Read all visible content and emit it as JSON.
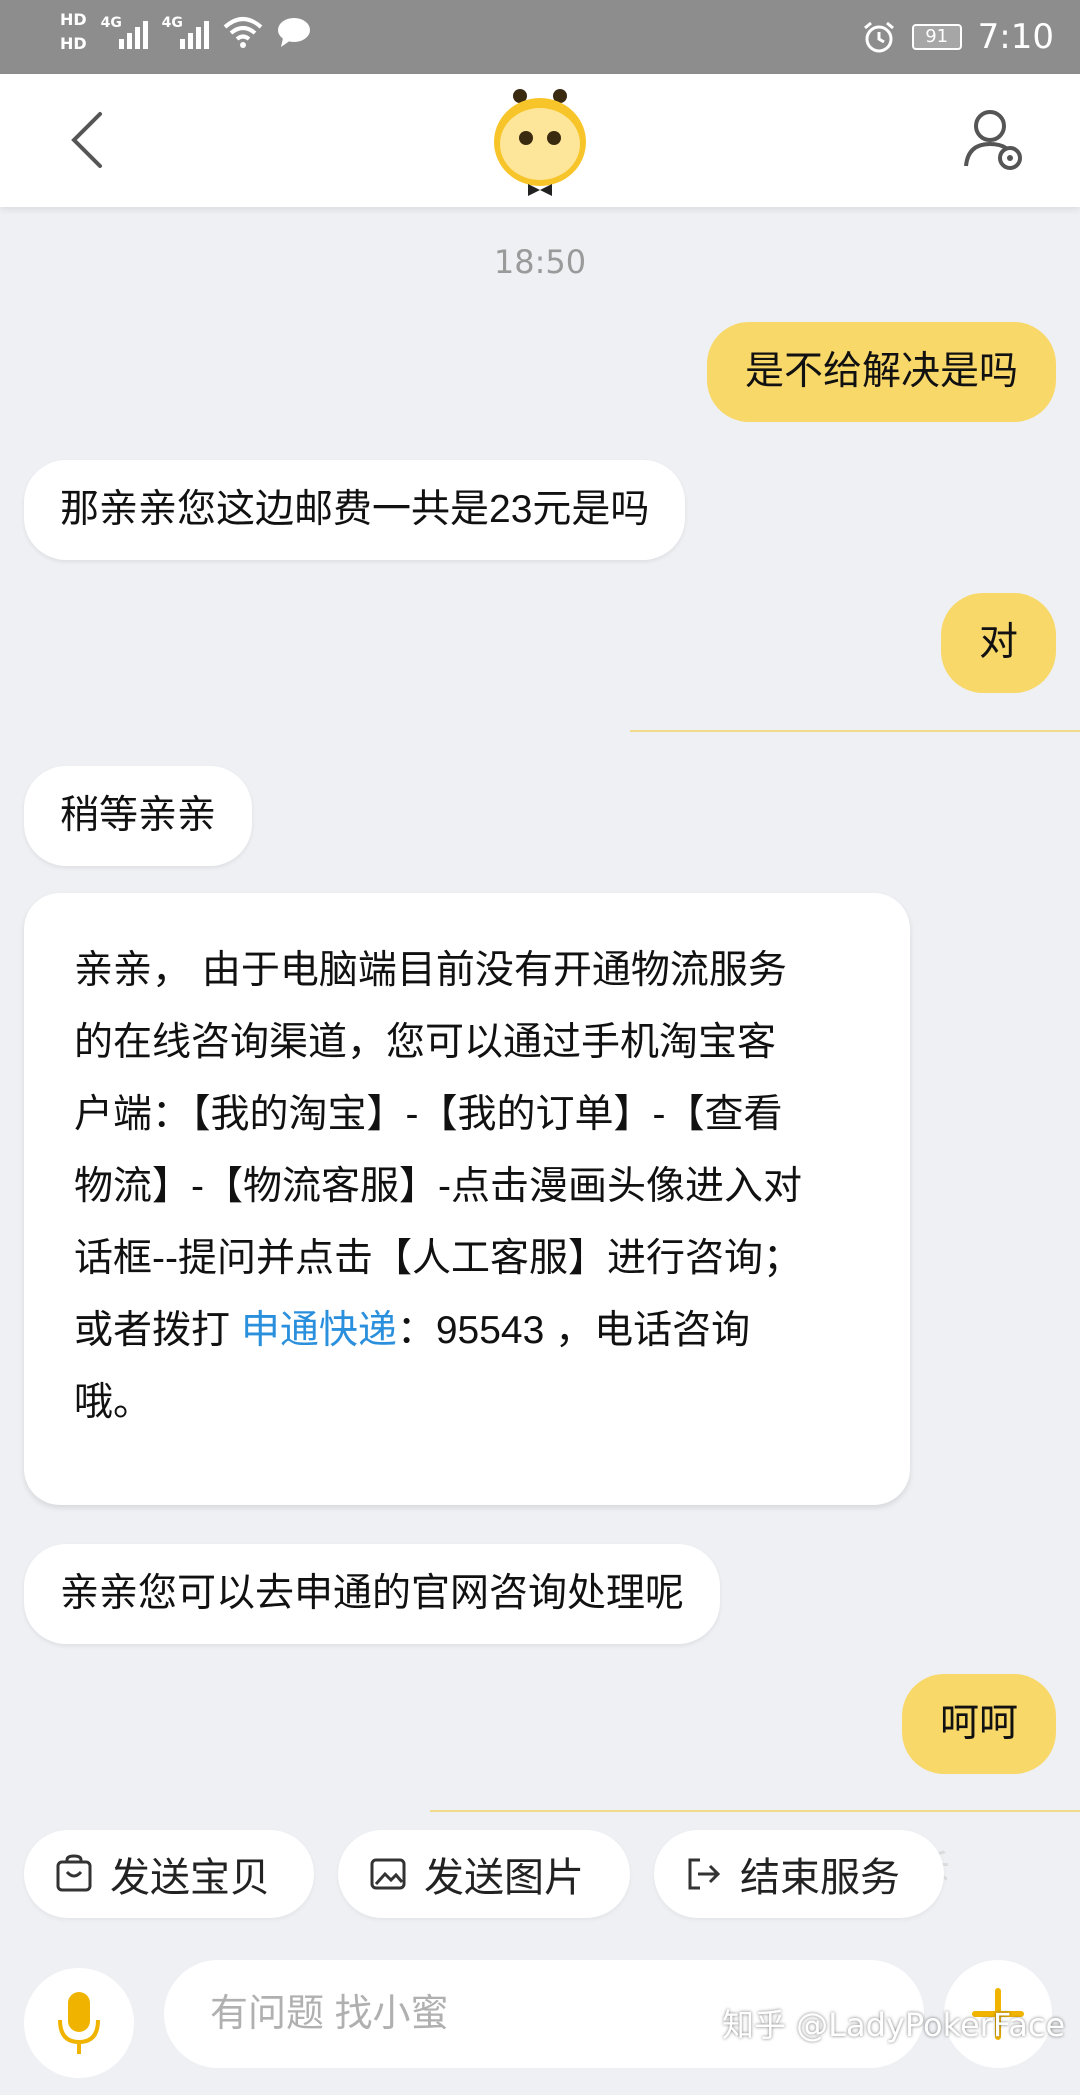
{
  "status_bar": {
    "hd1": "HD",
    "hd2": "HD",
    "signal_label": "4G",
    "battery": "91",
    "time": "7:10"
  },
  "header": {
    "back_icon": "chevron-left-icon",
    "mascot": "alimi-mascot",
    "profile_icon": "user-settings-icon"
  },
  "chat": {
    "timestamp": "18:50",
    "messages": [
      {
        "side": "out",
        "text": "是不给解决是吗"
      },
      {
        "side": "in",
        "text": "那亲亲您这边邮费一共是23元是吗"
      },
      {
        "side": "out",
        "text": "对"
      },
      {
        "side": "in",
        "text": "稍等亲亲"
      },
      {
        "side": "in",
        "text": "亲亲您可以去申通的官网咨询处理呢"
      },
      {
        "side": "out",
        "text": "呵呵"
      }
    ],
    "long_message": {
      "line1": "亲亲， 由于电脑端目前没有开通物流服务",
      "line2": "的在线咨询渠道，您可以通过手机淘宝客",
      "line3": "户端：【我的淘宝】-【我的订单】-【查看",
      "line4": "物流】-【物流客服】-点击漫画头像进入对",
      "line5": "话框--提问并点击【人工客服】进行咨询；",
      "line6_pre": "或者拨打 ",
      "line6_link": "申通快递",
      "line6_post": "：95543 ，电话咨询",
      "line7": "哦。"
    }
  },
  "quick_actions": {
    "send_item": "发送宝贝",
    "send_image": "发送图片",
    "end_service": "结束服务",
    "faded_text": "投诉"
  },
  "input": {
    "placeholder": "有问题 找小蜜",
    "mic_icon": "microphone-icon",
    "plus_icon": "plus-icon"
  },
  "watermark": "知乎 @LadyPokerFace",
  "colors": {
    "accent_yellow": "#f9d86a",
    "link_blue": "#2a8fdc",
    "background": "#eef0f4"
  }
}
